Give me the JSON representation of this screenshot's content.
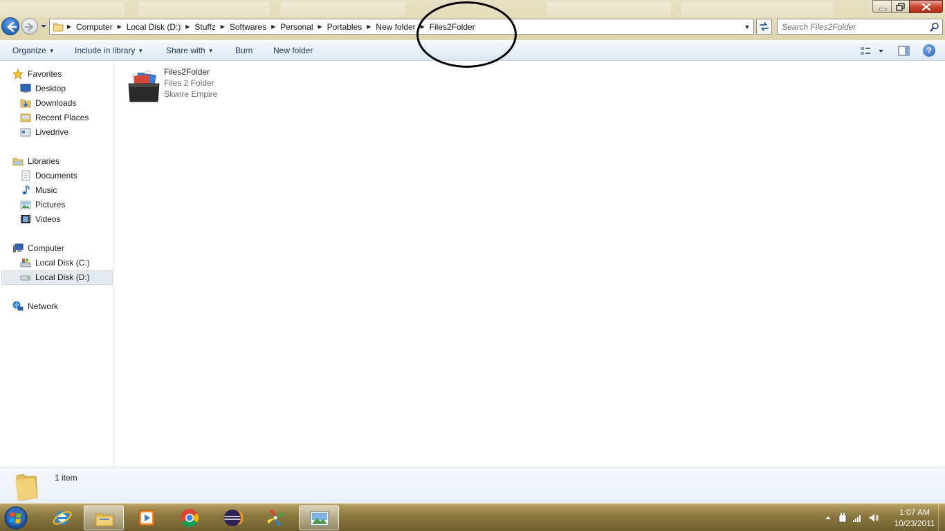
{
  "window": {
    "address_path": [
      "Computer",
      "Local Disk (D:)",
      "Stuffz",
      "Softwares",
      "Personal",
      "Portables",
      "New folder",
      "Files2Folder"
    ],
    "search_placeholder": "Search Files2Folder"
  },
  "command_bar": {
    "organize": "Organize",
    "include_in_library": "Include in library",
    "share_with": "Share with",
    "burn": "Burn",
    "new_folder": "New folder"
  },
  "nav_pane": {
    "favorites": {
      "label": "Favorites",
      "items": [
        "Desktop",
        "Downloads",
        "Recent Places",
        "Livedrive"
      ]
    },
    "libraries": {
      "label": "Libraries",
      "items": [
        "Documents",
        "Music",
        "Pictures",
        "Videos"
      ]
    },
    "computer": {
      "label": "Computer",
      "items": [
        "Local Disk (C:)",
        "Local Disk (D:)"
      ],
      "selected": "Local Disk (D:)"
    },
    "network": {
      "label": "Network"
    }
  },
  "content": {
    "files": [
      {
        "name": "Files2Folder",
        "description": "Files 2 Folder",
        "company": "Skwire Empire"
      }
    ]
  },
  "details_pane": {
    "item_count": "1 item"
  },
  "taskbar": {
    "pinned": [
      "internet-explorer",
      "windows-explorer",
      "media-player",
      "chrome",
      "eclipse",
      "pinwheel-app",
      "image-viewer"
    ],
    "clock_time": "1:07 AM",
    "clock_date": "10/23/2011"
  },
  "colors": {
    "title_bar": "#e4dcb9",
    "command_bar": "#e9f0f8",
    "command_text": "#1e395b",
    "selected_nav": "#e5eaef",
    "taskbar": "#8c7a41",
    "annotation_circle": "#000000"
  }
}
